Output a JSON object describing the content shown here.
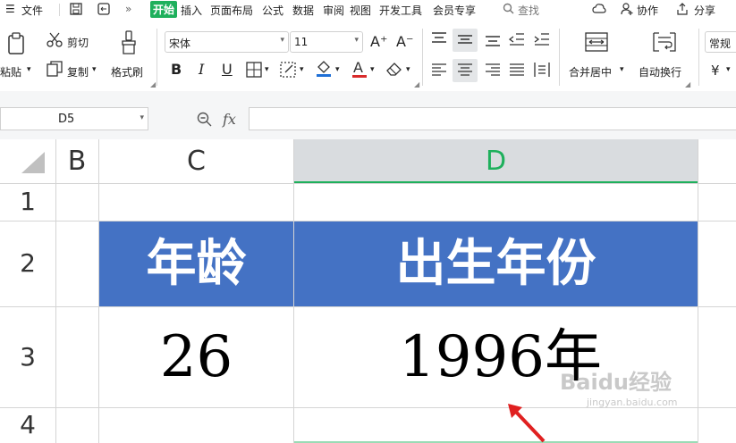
{
  "menu": {
    "file": "文件",
    "more": "»",
    "tabs": [
      "开始",
      "插入",
      "页面布局",
      "公式",
      "数据",
      "审阅",
      "视图",
      "开发工具",
      "会员专享"
    ],
    "search": "查找",
    "collab": "协作",
    "share": "分享"
  },
  "ribbon": {
    "paste": "粘贴",
    "cut": "剪切",
    "copy": "复制",
    "format_painter": "格式刷",
    "font_name": "宋体",
    "font_size": "11",
    "bold": "B",
    "italic": "I",
    "underline": "U",
    "font_grow": "A⁺",
    "font_shrink": "A⁻",
    "merge_center": "合并居中",
    "wrap_text": "自动换行",
    "number_format": "常规",
    "currency": "¥"
  },
  "formula_bar": {
    "name_box": "D5",
    "fx": "fx"
  },
  "sheet": {
    "columns": [
      "B",
      "C",
      "D"
    ],
    "rows": [
      "1",
      "2",
      "3",
      "4"
    ],
    "cells": {
      "C2": "年龄",
      "D2": "出生年份",
      "C3": "26",
      "D3": "1996年"
    },
    "header_fill": "#4472c4",
    "selected_column_color": "#1eb05c"
  },
  "watermark": {
    "brand": "Baidu经验",
    "url": "jingyan.baidu.com"
  }
}
